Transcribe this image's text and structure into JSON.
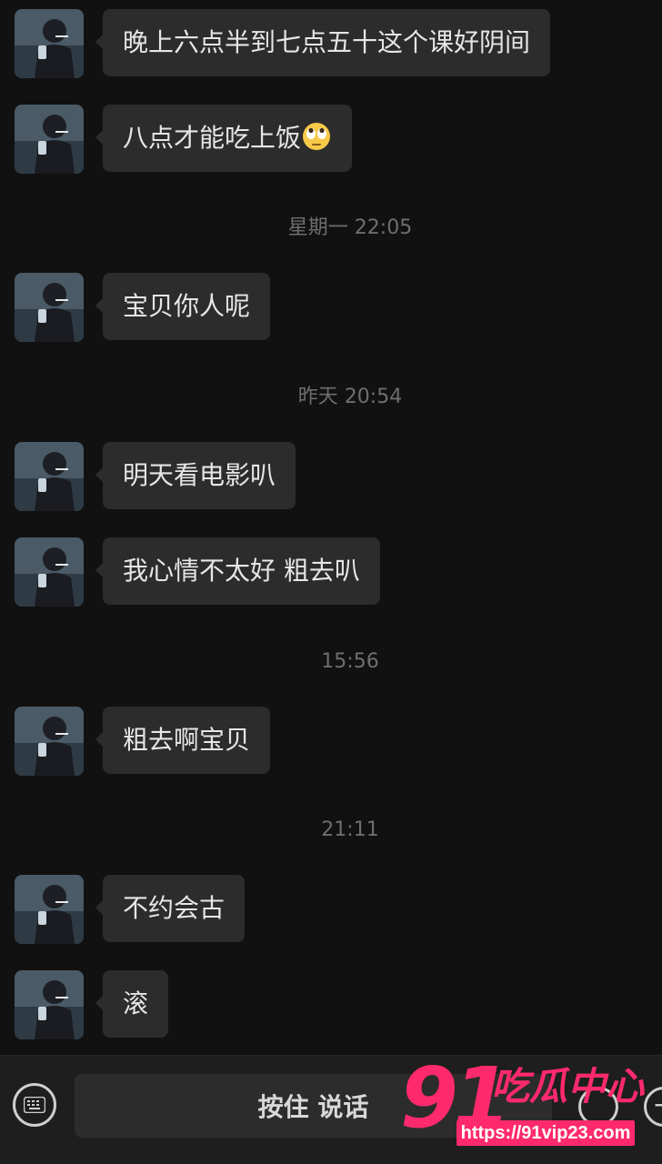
{
  "messages": [
    {
      "text": "晚上六点半到七点五十这个课好阴间"
    },
    {
      "text": "八点才能吃上饭",
      "emoji": "eye-roll-emoji"
    },
    {
      "text": "宝贝你人呢"
    },
    {
      "text": "明天看电影叭"
    },
    {
      "text": "我心情不太好 粗去叭"
    },
    {
      "text": "粗去啊宝贝"
    },
    {
      "text": "不约会古"
    },
    {
      "text": "滚"
    }
  ],
  "timestamps": [
    "星期一 22:05",
    "昨天 20:54",
    "15:56",
    "21:11"
  ],
  "input_bar": {
    "hold_to_talk_label": "按住 说话",
    "keyboard_icon": "keyboard-icon",
    "emoji_icon": "smiley-icon",
    "plus_icon": "plus-icon"
  },
  "watermark": {
    "number": "91",
    "brand": "吃瓜中心",
    "url": "https://91vip23.com"
  },
  "colors": {
    "background": "#111111",
    "bubble": "#2c2c2c",
    "text": "#e6e6e6",
    "timestamp": "#6e6e6e",
    "watermark": "#ff2a6d"
  }
}
